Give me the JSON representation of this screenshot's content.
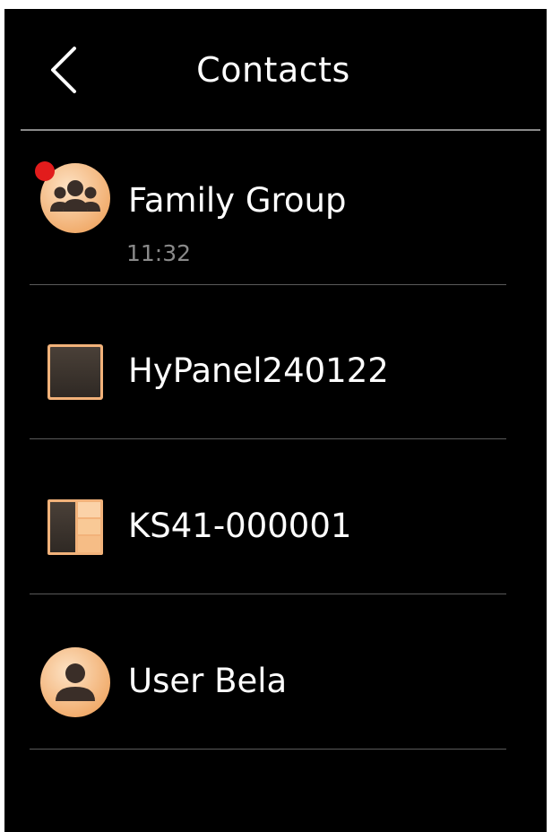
{
  "header": {
    "title": "Contacts",
    "back_icon": "chevron-left-icon"
  },
  "contacts": [
    {
      "name": "Family Group",
      "time": "11:32",
      "icon": "group-icon",
      "unread": true
    },
    {
      "name": "HyPanel240122",
      "icon": "indoor-monitor-icon"
    },
    {
      "name": "KS41-000001",
      "icon": "door-station-icon"
    },
    {
      "name": "User Bela",
      "icon": "user-icon"
    }
  ],
  "colors": {
    "background": "#000000",
    "accent": "#f4b37a",
    "unread": "#e21c1c",
    "divider": "#5a5a5a",
    "secondary_text": "#8a8a8a"
  }
}
